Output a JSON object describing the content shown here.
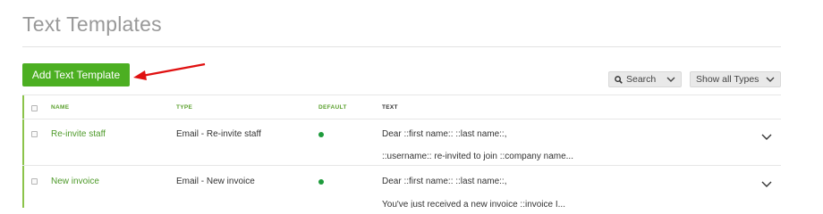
{
  "page": {
    "title": "Text Templates"
  },
  "toolbar": {
    "add_label": "Add Text Template",
    "search_label": "Search",
    "types_label": "Show all Types"
  },
  "table": {
    "columns": [
      "NAME",
      "TYPE",
      "DEFAULT",
      "TEXT"
    ],
    "rows": [
      {
        "name": "Re-invite staff",
        "type": "Email - Re-invite staff",
        "default": true,
        "text_line1": "Dear ::first name:: ::last name::,",
        "text_line2": "::username:: re-invited to join ::company name..."
      },
      {
        "name": "New invoice",
        "type": "Email - New invoice",
        "default": true,
        "text_line1": "Dear ::first name:: ::last name::,",
        "text_line2": "You've just received a new invoice ::invoice I..."
      }
    ]
  },
  "icons": {
    "search": "magnifier-icon",
    "dropdown": "chevron-down-icon",
    "expand": "chevron-down-icon",
    "annotation": "red-arrow-icon"
  },
  "colors": {
    "accent_green": "#4caf22",
    "link_green": "#4e9a2a",
    "default_dot": "#1e9b3c",
    "annotation_red": "#e01010",
    "title_gray": "#999999"
  }
}
